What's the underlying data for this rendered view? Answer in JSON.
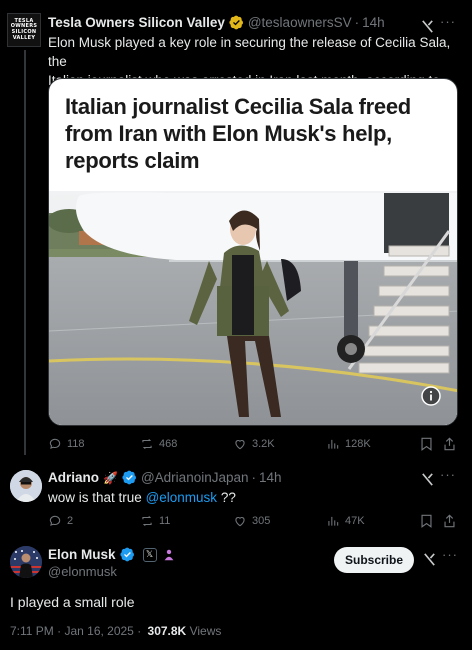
{
  "post": {
    "avatar_lines": [
      "TESLA",
      "OWNERS",
      "SILICON",
      "VALLEY"
    ],
    "author_name": "Tesla Owners Silicon Valley",
    "handle": "@teslaownersSV",
    "separator": "·",
    "time": "14h",
    "text_line1": "Elon Musk played a key role in securing the release of Cecilia Sala, the",
    "text_line2": "Italian journalist who was arrested in Iran last month, according to reports.",
    "card_headline_line1": "Italian journalist Cecilia Sala freed",
    "card_headline_line2": "from Iran with Elon Musk's help,",
    "card_headline_line3": "reports claim",
    "stats": {
      "replies": "118",
      "reposts": "468",
      "likes": "3.2K",
      "views": "128K"
    },
    "colors": {
      "verified_badge": "#e2b719"
    }
  },
  "reply": {
    "author_name": "Adriano",
    "emoji": "🚀",
    "handle": "@AdrianoinJapan",
    "separator": "·",
    "time": "14h",
    "text_prefix": "wow is that true",
    "mention": "@elonmusk",
    "text_suffix": "??",
    "stats": {
      "replies": "2",
      "reposts": "11",
      "likes": "305",
      "views": "47K"
    }
  },
  "main": {
    "author_name": "Elon Musk",
    "badge_x": "𝕏",
    "handle": "@elonmusk",
    "subscribe_label": "Subscribe",
    "text": "I played a small role",
    "timestamp": "7:11 PM · Jan 16, 2025 ·",
    "views_count": "307.8K",
    "views_label": "Views"
  },
  "icons": [
    "verified-badge-icon",
    "grok-icon",
    "more-icon",
    "reply-icon",
    "repost-icon",
    "like-icon",
    "views-icon",
    "bookmark-icon",
    "share-icon",
    "info-icon"
  ]
}
